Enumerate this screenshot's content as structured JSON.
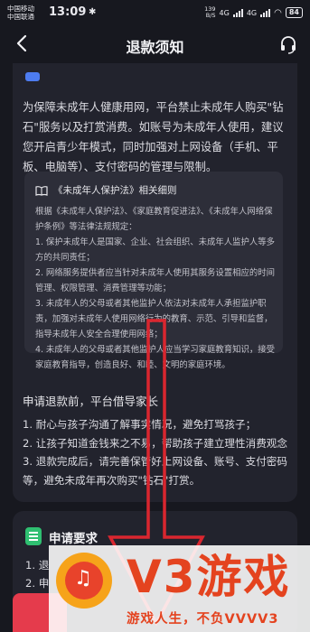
{
  "status_bar": {
    "carrier_1": "中国移动",
    "carrier_2": "中国联通",
    "time": "13:09",
    "net_speed_value": "139",
    "net_speed_unit": "B/S",
    "network_1": "4G",
    "network_2": "4G",
    "battery": "84"
  },
  "header": {
    "title": "退款须知",
    "back_icon": "chevron-left-icon",
    "service_icon": "headset-icon"
  },
  "intro": {
    "text": "为保障未成年人健康用网，平台禁止未成年人购买\"钻石\"服务以及打赏消费。如账号为未成年人使用，建议您开启青少年模式，同时加强对上网设备（手机、平板、电脑等）、支付密码的管理与限制。"
  },
  "law_box": {
    "title": "《未成年人保护法》相关细则",
    "lines": [
      "根据《未成年人保护法》、《家庭教育促进法》、《未成年人网络保护条例》等法律法规规定：",
      "1. 保护未成年人是国家、企业、社会组织、未成年人监护人等多方的共同责任；",
      "2. 网络服务提供者应当针对未成年人使用其服务设置相应的时间管理、权限管理、消费管理等功能；",
      "3. 未成年人的父母或者其他监护人依法对未成年人承担监护职责，加强对未成年人使用网络行为的教育、示范、引导和监督，指导未成年人安全合理使用网络；",
      "4. 未成年人的父母或者其他监护人应当学习家庭教育知识，接受家庭教育指导，创造良好、和睦、文明的家庭环境。"
    ]
  },
  "reminder": {
    "title": "申请退款前，平台借导家长",
    "items": [
      "1. 耐心与孩子沟通了解事实情况，避免打骂孩子；",
      "2. 让孩子知道金钱来之不易，帮助孩子建立理性消费观念",
      "3. 退款完成后，请完善保管好上网设备、账号、支付密码等，避免未成年再次购买\"钻石\"打赏。"
    ]
  },
  "requirements": {
    "title": "申请要求",
    "items": [
      "1. 退",
      "2. 申"
    ]
  },
  "watermark": {
    "brand": "V3游戏",
    "slogan": "游戏人生，不负VVVV3"
  },
  "colors": {
    "background": "#17181f",
    "card": "#22232d",
    "law_box": "#2d2e39",
    "accent_blue": "#4d7cf0",
    "accent_green": "#2fbf71",
    "button_red": "#e53b4c",
    "arrow_red": "#d9262f",
    "watermark_orange": "#e4431f"
  }
}
